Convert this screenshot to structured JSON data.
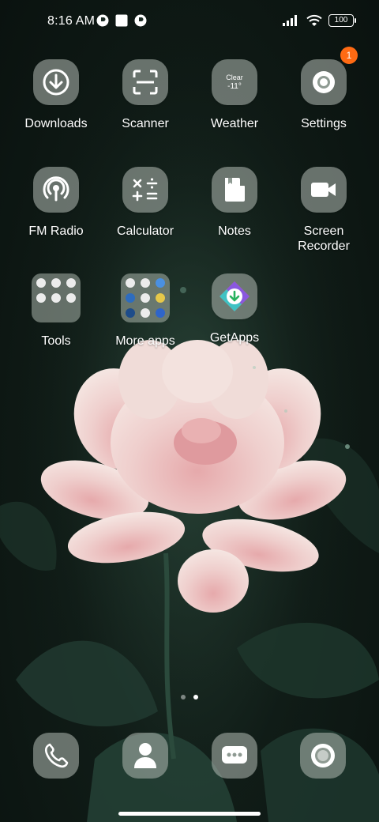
{
  "status_bar": {
    "time": "8:16 AM",
    "notification_icons": [
      "circle-p-icon",
      "square-icon",
      "circle-p-icon"
    ],
    "signal_icon": "signal-icon",
    "wifi_icon": "wifi-icon",
    "battery": "100"
  },
  "apps": [
    {
      "label": "Downloads",
      "icon": "download-icon"
    },
    {
      "label": "Scanner",
      "icon": "scan-icon"
    },
    {
      "label": "Weather",
      "icon": "weather-icon",
      "condition": "Clear",
      "temp": "-11°"
    },
    {
      "label": "Settings",
      "icon": "gear-icon",
      "badge": "1"
    },
    {
      "label": "FM Radio",
      "icon": "radio-icon"
    },
    {
      "label": "Calculator",
      "icon": "calculator-icon"
    },
    {
      "label": "Notes",
      "icon": "notes-icon"
    },
    {
      "label": "Screen\nRecorder",
      "icon": "video-camera-icon"
    },
    {
      "label": "Tools",
      "icon": "folder-icon"
    },
    {
      "label": "More apps",
      "icon": "folder-icon"
    },
    {
      "label": "GetApps",
      "icon": "getapps-icon"
    }
  ],
  "page_indicator": {
    "pages": 2,
    "current": 2
  },
  "dock": [
    {
      "icon": "phone-icon"
    },
    {
      "icon": "contacts-icon"
    },
    {
      "icon": "messages-icon"
    },
    {
      "icon": "camera-icon"
    }
  ],
  "colors": {
    "badge": "#ff6a13",
    "icon_bg": "#aab4ac",
    "accent": "#ffffff"
  }
}
